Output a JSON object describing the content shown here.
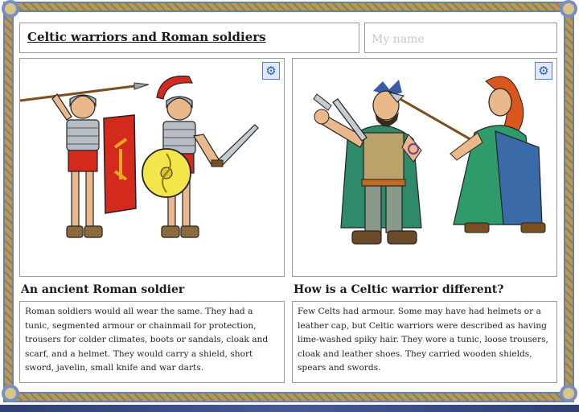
{
  "worksheet": {
    "title": "Celtic warriors and Roman soldiers",
    "name_placeholder": "My name",
    "left_panel": {
      "heading": "An ancient Roman soldier",
      "body": "Roman soldiers would all wear the same. They had a tunic, segmented armour or chainmail for protection, trousers for colder climates, boots or sandals, cloak and scarf, and a helmet. They would carry a shield, short sword, javelin, small knife and war darts.",
      "settings_icon": "gear-icon"
    },
    "right_panel": {
      "heading": "How is a Celtic warrior different?",
      "body": "Few Celts had armour. Some may have had helmets or a leather cap, but Celtic warriors were described as having lime-washed spiky hair. They wore a tunic, loose trousers, cloak and leather shoes. They carried wooden shields, spears and swords.",
      "settings_icon": "gear-icon"
    }
  },
  "colors": {
    "border_gold": "#b89a4e",
    "border_blue": "#6b7fa8",
    "roman_red": "#d42a1e",
    "celt_green": "#2f9a6a",
    "celt_hair": "#d9561c"
  }
}
